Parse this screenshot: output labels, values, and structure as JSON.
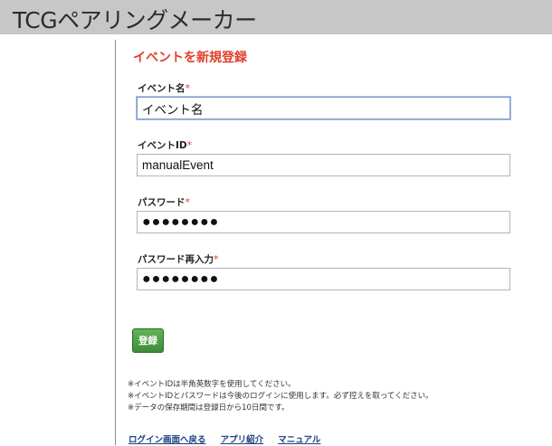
{
  "header": {
    "title": "TCGペアリングメーカー"
  },
  "form": {
    "heading": "イベントを新規登録",
    "required_mark": "*",
    "fields": {
      "event_name": {
        "label": "イベント名",
        "value": "イベント名"
      },
      "event_id": {
        "label": "イベントID",
        "value": "manualEvent"
      },
      "password": {
        "label": "パスワード",
        "value": "●●●●●●●●"
      },
      "password_confirm": {
        "label": "パスワード再入力",
        "value": "●●●●●●●●"
      }
    },
    "submit_label": "登録"
  },
  "notes": [
    "※イベントIDは半角英数字を使用してください。",
    "※イベントIDとパスワードは今後のログインに使用します。必ず控えを取ってください。",
    "※データの保存期間は登録日から10日間です。"
  ],
  "footer": {
    "links": [
      "ログイン画面へ戻る",
      "アプリ紹介",
      "マニュアル"
    ]
  },
  "colors": {
    "header_bg": "#c7c7c7",
    "heading": "#e0402a",
    "required": "#e0402a",
    "button": "#4a9a41",
    "link": "#1e3f80"
  }
}
